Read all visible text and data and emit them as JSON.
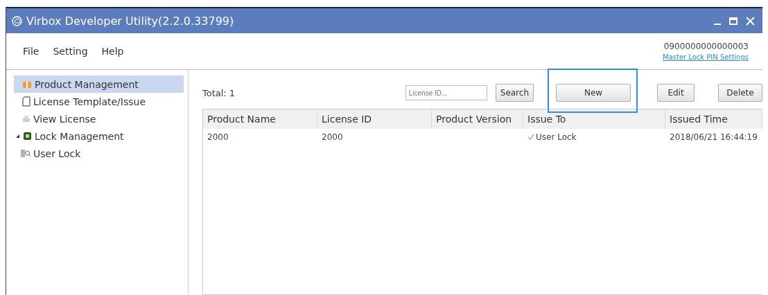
{
  "window": {
    "title": "Virbox Developer Utility(2.2.0.33799)"
  },
  "menu": [
    "File",
    "Setting",
    "Help"
  ],
  "account": {
    "id": "0900000000000003",
    "link": "Master Lock PIN Settings"
  },
  "sidebar": {
    "items": [
      {
        "label": "Product Management",
        "selected": true
      },
      {
        "label": "License Template/Issue",
        "selected": false
      },
      {
        "label": "View License",
        "selected": false
      },
      {
        "label": "Lock Management",
        "selected": false,
        "expanded": true,
        "children": [
          {
            "label": "User Lock",
            "selected": false
          }
        ]
      }
    ]
  },
  "toolbar": {
    "total": "Total: 1",
    "search": {
      "placeholder": "License ID..."
    },
    "buttons": [
      {
        "label": "Search",
        "highlighted": false
      },
      {
        "label": "New",
        "highlighted": true
      },
      {
        "label": "Edit",
        "highlighted": false
      },
      {
        "label": "Delete",
        "highlighted": false
      }
    ]
  },
  "table": {
    "columns": [
      "Product Name",
      "License ID",
      "Product Version",
      "Issue To",
      "Issued Time"
    ],
    "rows": [
      {
        "cells": [
          "2000",
          "2000",
          "",
          "User Lock",
          "2018/06/21 16:44:19"
        ],
        "checked": true
      }
    ]
  }
}
